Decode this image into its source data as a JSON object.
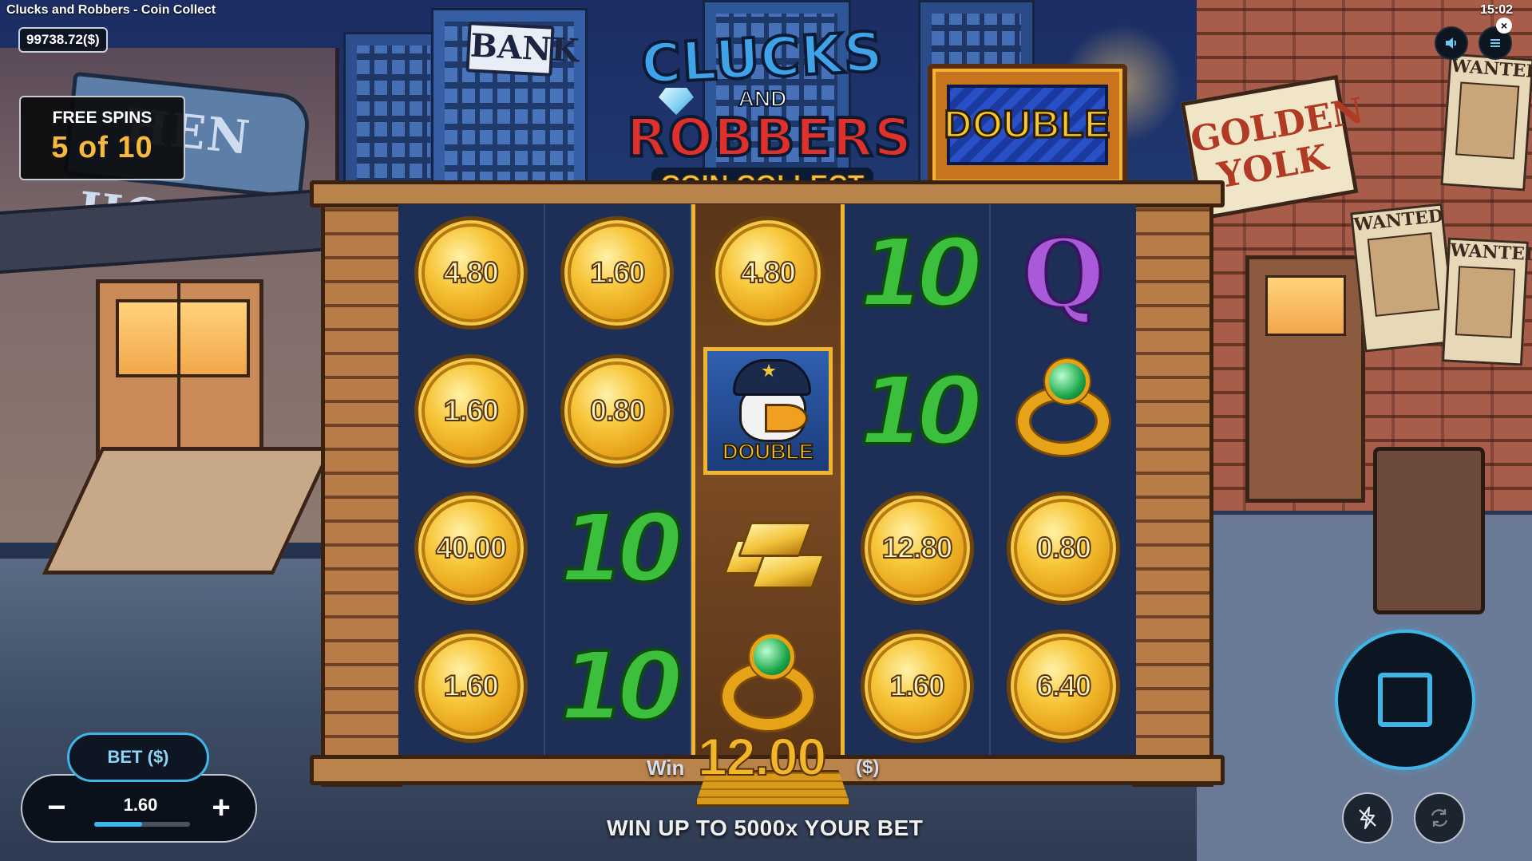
{
  "header": {
    "title": "Clucks and Robbers - Coin Collect",
    "clock": "15:02",
    "balance": "99738.72($)"
  },
  "scene": {
    "bank_sign": "BANK",
    "hen_house_sign": "HEN HOUSE",
    "golden_yolk_sign": "GOLDEN YOLK",
    "wanted_label": "WANTED"
  },
  "free_spins": {
    "label": "FREE SPINS",
    "count": "5 of 10"
  },
  "logo": {
    "line1": "CLUCKS",
    "line2": "AND",
    "line3": "ROBBERS",
    "line4": "COIN COLLECT"
  },
  "double_sign": "DOUBLE",
  "reels": [
    [
      "coin:4.80",
      "coin:1.60",
      "coin:40.00",
      "coin:1.60"
    ],
    [
      "coin:1.60",
      "coin:0.80",
      "ten",
      "ten"
    ],
    [
      "coin:4.80",
      "police:DOUBLE",
      "gold",
      "ring"
    ],
    [
      "ten",
      "ten",
      "coin:12.80",
      "coin:1.60"
    ],
    [
      "queen",
      "ring",
      "coin:0.80",
      "coin:6.40"
    ]
  ],
  "symbols": {
    "ten_label": "10",
    "queen_label": "Q"
  },
  "win": {
    "label": "Win",
    "amount": "12.00",
    "unit": "($)"
  },
  "promo": "WIN UP TO 5000x YOUR BET",
  "bet": {
    "label": "BET ($)",
    "value": "1.60",
    "minus": "−",
    "plus": "+",
    "slider_fraction": 0.5
  },
  "colors": {
    "accent": "#3fb6e8",
    "gold": "#f3b52a",
    "green_ten": "#3cbf3c",
    "queen_purple": "#a85ad8"
  },
  "icons": {
    "sound": "speaker-icon",
    "menu": "hamburger-icon",
    "close": "close-icon",
    "stop": "stop-icon",
    "turbo": "lightning-off-icon",
    "autoplay": "autoplay-icon"
  }
}
